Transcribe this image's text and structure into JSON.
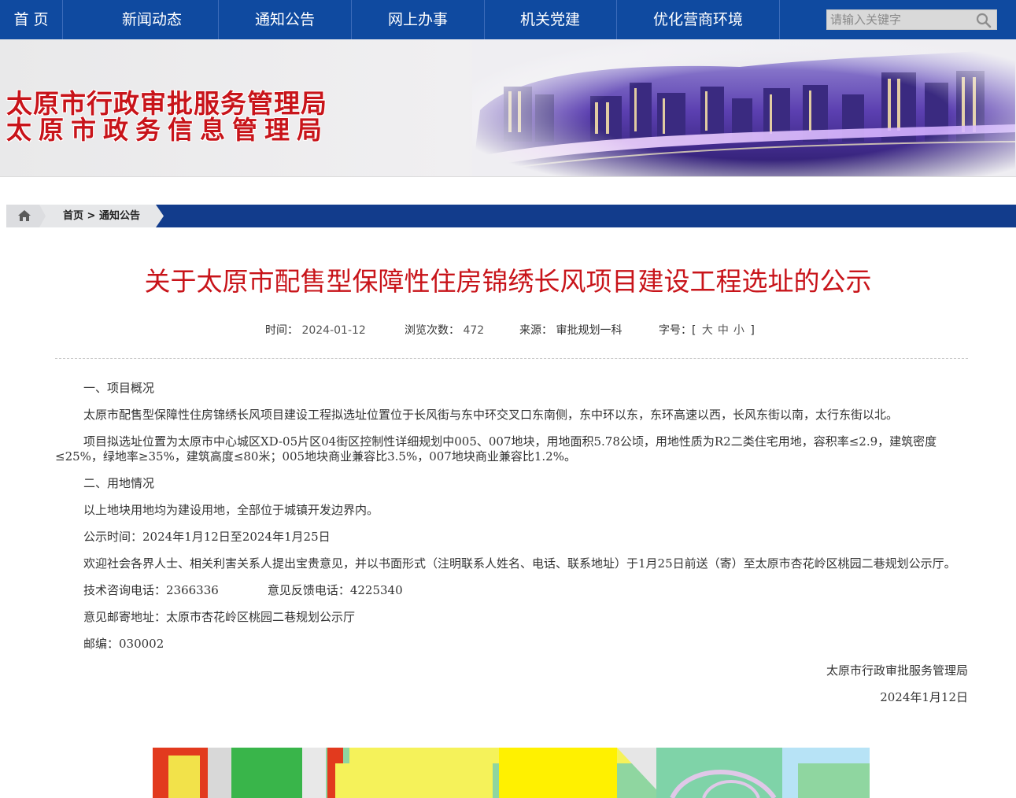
{
  "nav": {
    "items": [
      "首 页",
      "新闻动态",
      "通知公告",
      "网上办事",
      "机关党建",
      "优化营商环境"
    ],
    "search_placeholder": "请输入关键字"
  },
  "banner": {
    "line1": "太原市行政审批服务管理局",
    "line2": "太原市政务信息管理局"
  },
  "breadcrumb": {
    "home": "首页",
    "separator": " > ",
    "current": "通知公告"
  },
  "article": {
    "title": "关于太原市配售型保障性住房锦绣长风项目建设工程选址的公示",
    "meta": {
      "time_label": "时间：",
      "time_value": "2024-01-12",
      "views_label": "浏览次数：",
      "views_value": "472",
      "source_label": "来源：",
      "source_value": "审批规划一科",
      "font_label": "字号：",
      "font_open": "[",
      "font_large": "大",
      "font_medium": "中",
      "font_small": "小",
      "font_close": "]"
    },
    "paragraphs": {
      "h1": "一、项目概况",
      "p1": "太原市配售型保障性住房锦绣长风项目建设工程拟选址位置位于长风街与东中环交叉口东南侧，东中环以东，东环高速以西，长风东街以南，太行东街以北。",
      "p2": "项目拟选址位置为太原市中心城区XD-05片区04街区控制性详细规划中005、007地块，用地面积5.78公顷，用地性质为R2二类住宅用地，容积率≤2.9，建筑密度≤25%，绿地率≥35%，建筑高度≤80米；005地块商业兼容比3.5%，007地块商业兼容比1.2%。",
      "h2": "二、用地情况",
      "p3": "以上地块用地均为建设用地，全部位于城镇开发边界内。",
      "p4": "公示时间：2024年1月12日至2024年1月25日",
      "p5": "欢迎社会各界人士、相关利害关系人提出宝贵意见，并以书面形式（注明联系人姓名、电话、联系地址）于1月25日前送（寄）至太原市杏花岭区桃园二巷规划公示厅。",
      "tech_phone": "技术咨询电话：2366336",
      "feedback_phone": "意见反馈电话：4225340",
      "address": "意见邮寄地址：太原市杏花岭区桃园二巷规划公示厅",
      "postcode": "邮编：030002",
      "signature": "太原市行政审批服务管理局",
      "date": "2024年1月12日"
    }
  },
  "colors": {
    "nav_bg": "#0f4aa0",
    "title_red": "#c8141a",
    "breadcrumb_dark": "#123c8c"
  },
  "icons": {
    "search": "magnifier",
    "home": "house"
  }
}
